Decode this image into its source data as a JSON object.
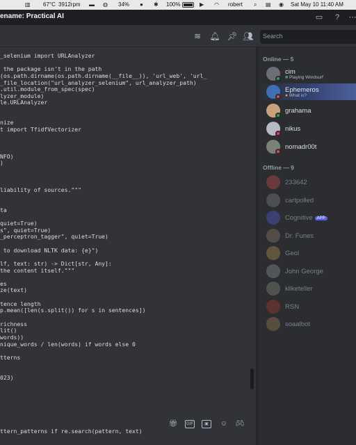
{
  "menubar": {
    "temperature": "67°C",
    "cpu_rpm": "3912rpm",
    "percent": "34%",
    "battery": "100%",
    "user": "robert",
    "datetime": "Sat May 10  11:40 AM"
  },
  "window": {
    "title": "ename: Practical AI"
  },
  "header": {
    "search_placeholder": "Search"
  },
  "code_lines": [
    "_selenium import URLAnalyzer",
    "",
    " the package isn't in the path",
    "(os.path.dirname(os.path.dirname(__file__)), 'url_web', 'url_",
    "_file_location(\"url_analyzer_selenium\", url_analyzer_path)",
    ".util.module_from_spec(spec)",
    "lyzer_module)",
    "le.URLAnalyzer",
    "",
    "",
    "nize",
    "t import TfidfVectorizer",
    "",
    "",
    "",
    "NFO)",
    ")",
    "",
    "",
    "",
    "liability of sources.\"\"\"",
    "",
    "",
    "ta",
    "",
    "quiet=True)",
    "s\", quiet=True)",
    "_perceptron_tagger\", quiet=True)",
    "",
    " to download NLTK data: {e}\")",
    "",
    "lf, text: str) -> Dict[str, Any]:",
    "the content itself.\"\"\"",
    "",
    "es",
    "ze(text)",
    "",
    "tence length",
    "p.mean([len(s.split()) for s in sentences])",
    "",
    "richness",
    "lit()",
    "words))",
    "nique_words / len(words) if words else 0",
    "",
    "tterns",
    "",
    "",
    "023)",
    "",
    "",
    "",
    "",
    "",
    "",
    "",
    "ttern_patterns if re.search(pattern, text)"
  ],
  "members": {
    "online_header": "Online — 5",
    "offline_header": "Offline — 9",
    "online": [
      {
        "name": "cim",
        "activity": "Playing Windsurf",
        "status": "online",
        "color": "#e3e5e8",
        "avatar_color": "#6d6f78"
      },
      {
        "name": "Ephemeros",
        "activity": "What is?",
        "status": "dnd",
        "color": "#e3e5e8",
        "avatar_color": "#3f6fb5"
      },
      {
        "name": "grahama",
        "activity": "",
        "status": "online",
        "color": "#dbdee1",
        "avatar_color": "#c9a27a"
      },
      {
        "name": "nikus",
        "activity": "",
        "status": "dnd",
        "color": "#dbdee1",
        "avatar_color": "#b7b9c4"
      },
      {
        "name": "nomadr00t",
        "activity": "",
        "status": "dnd",
        "color": "#dbdee1",
        "avatar_color": "#7a8178"
      }
    ],
    "offline": [
      {
        "name": "233642",
        "badge": "",
        "avatar_color": "#d9534f"
      },
      {
        "name": "cartpolled",
        "badge": "",
        "avatar_color": "#8a8d94"
      },
      {
        "name": "Cognitive",
        "badge": "APP",
        "avatar_color": "#5865f2"
      },
      {
        "name": "Dr. Funes",
        "badge": "",
        "avatar_color": "#a08a70"
      },
      {
        "name": "Geol",
        "badge": "",
        "avatar_color": "#c7a05a"
      },
      {
        "name": "John George",
        "badge": "",
        "avatar_color": "#9aa0a6"
      },
      {
        "name": "kliketeller",
        "badge": "",
        "avatar_color": "#8f9a8b"
      },
      {
        "name": "RSN",
        "badge": "",
        "avatar_color": "#c0392b"
      },
      {
        "name": "soaalbot",
        "badge": "",
        "avatar_color": "#b08a5a"
      }
    ]
  },
  "colors": {
    "online": "#23a55a",
    "dnd": "#f23f43"
  }
}
